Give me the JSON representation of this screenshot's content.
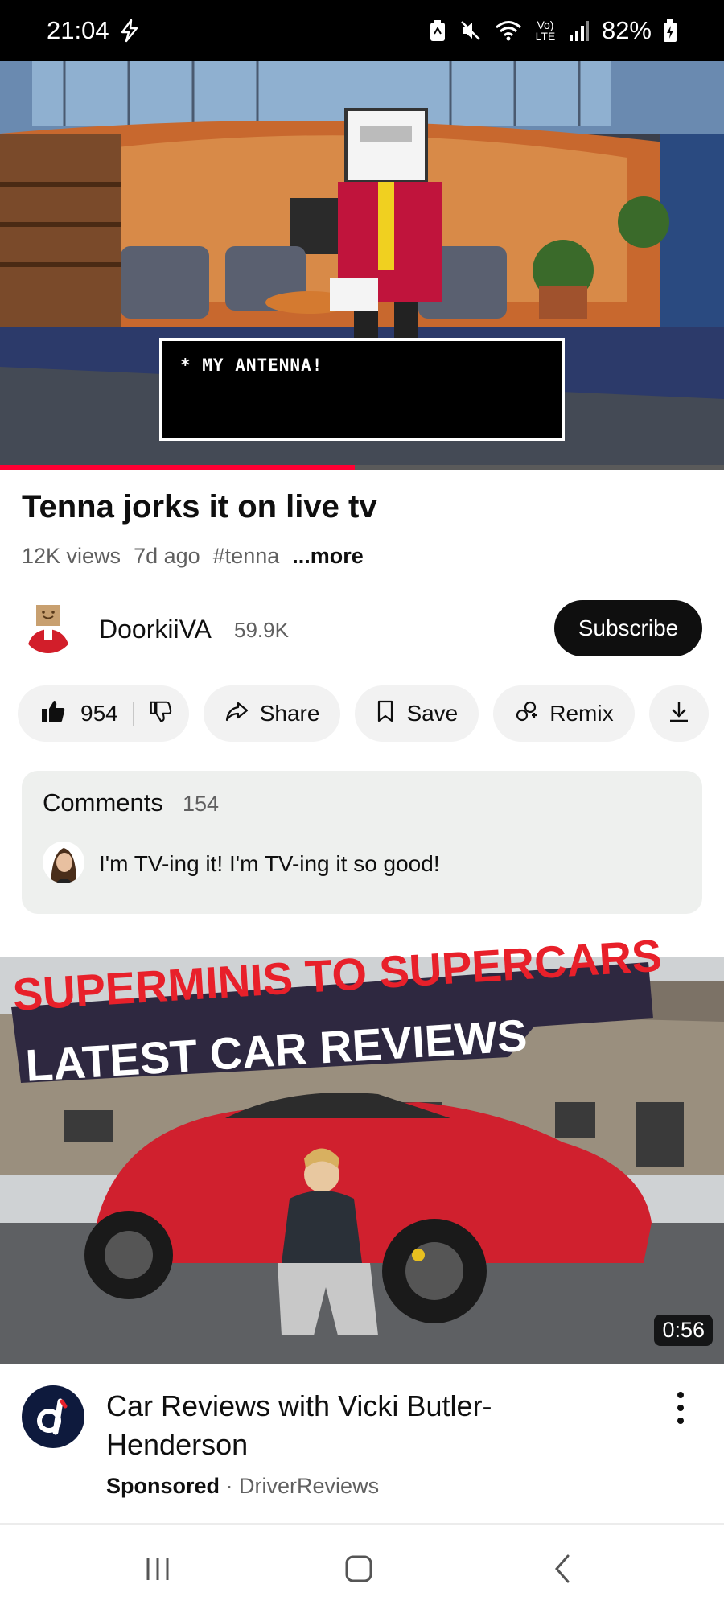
{
  "status_bar": {
    "time": "21:04",
    "network_label": "Vo) LTE",
    "battery": "82%"
  },
  "player": {
    "dialog_text": "* MY ANTENNA!",
    "progress_fraction": 0.49
  },
  "video": {
    "title": "Tenna jorks it on live tv",
    "views": "12K views",
    "age": "7d ago",
    "hashtag": "#tenna",
    "more_label": "...more"
  },
  "channel": {
    "name": "DoorkiiVA",
    "subscribers": "59.9K",
    "subscribe_label": "Subscribe"
  },
  "actions": {
    "like_count": "954",
    "share_label": "Share",
    "save_label": "Save",
    "remix_label": "Remix"
  },
  "comments": {
    "title": "Comments",
    "count": "154",
    "top_comment": "I'm TV-ing it! I'm TV-ing it so good!"
  },
  "ad": {
    "banner_line1": "SUPERMINIS TO SUPERCARS",
    "banner_line2": "LATEST CAR REVIEWS",
    "duration": "0:56",
    "title": "Car Reviews with Vicki Butler-Henderson",
    "sponsored_label": "Sponsored",
    "separator": "·",
    "advertiser": "DriverReviews"
  },
  "colors": {
    "accent": "#ff0033",
    "subscribe_bg": "#0f0f0f",
    "pill_bg": "#f2f2f2",
    "comments_bg": "#eef0ee",
    "ad_red": "#e8202a"
  }
}
